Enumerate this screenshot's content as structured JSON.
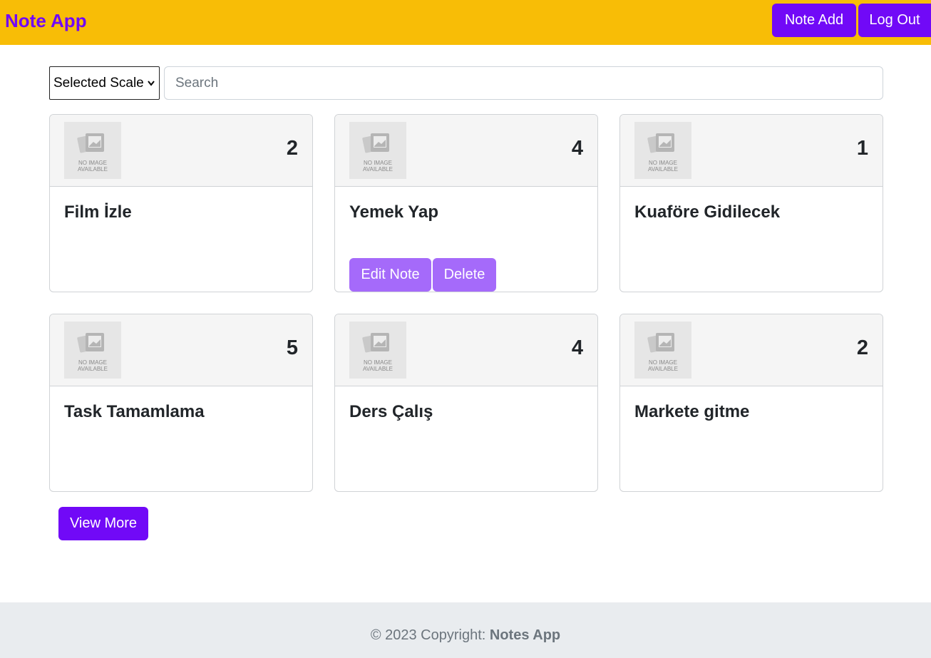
{
  "navbar": {
    "brand": "Note App",
    "note_add_label": "Note Add",
    "logout_label": "Log Out"
  },
  "filters": {
    "scale_select": "Selected Scale",
    "search_placeholder": "Search"
  },
  "notes": [
    {
      "title": "Film İzle",
      "scale": "2",
      "image_text_1": "NO IMAGE",
      "image_text_2": "AVAILABLE"
    },
    {
      "title": "Yemek Yap",
      "scale": "4",
      "image_text_1": "NO IMAGE",
      "image_text_2": "AVAILABLE",
      "edit_label": "Edit Note",
      "delete_label": "Delete"
    },
    {
      "title": "Kuaföre Gidilecek",
      "scale": "1",
      "image_text_1": "NO IMAGE",
      "image_text_2": "AVAILABLE"
    },
    {
      "title": "Task Tamamlama",
      "scale": "5",
      "image_text_1": "NO IMAGE",
      "image_text_2": "AVAILABLE"
    },
    {
      "title": "Ders Çalış",
      "scale": "4",
      "image_text_1": "NO IMAGE",
      "image_text_2": "AVAILABLE"
    },
    {
      "title": "Markete gitme",
      "scale": "2",
      "image_text_1": "NO IMAGE",
      "image_text_2": "AVAILABLE"
    }
  ],
  "view_more_label": "View More",
  "footer": {
    "copyright": "© 2023 Copyright:",
    "app_name": "Notes App"
  },
  "colors": {
    "navbar": "#f8bd06",
    "brand_text": "#7109f7",
    "primary_button": "#7109f7",
    "card_action_button": "#a56afa",
    "footer_bg": "#e9ecef"
  },
  "icons": {
    "placeholder_image": "no-image-icon",
    "select_arrow": "chevron-down-icon"
  }
}
